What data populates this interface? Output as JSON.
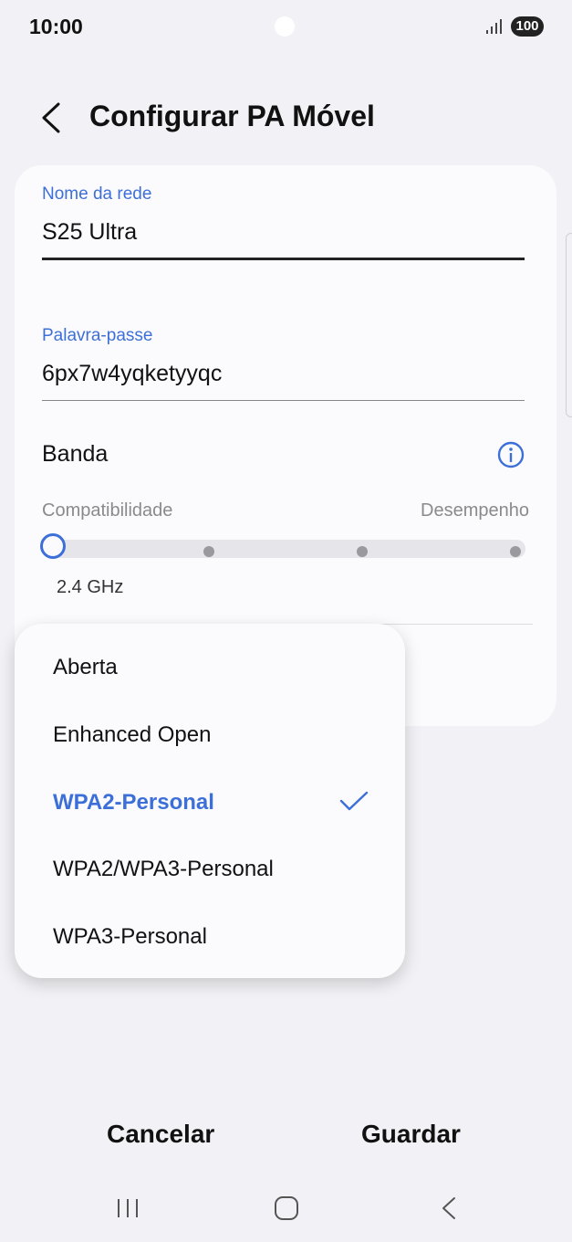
{
  "status_bar": {
    "time": "10:00",
    "battery": "100",
    "signal_icon": "signal-bars-icon"
  },
  "header": {
    "title": "Configurar PA Móvel",
    "back_icon": "chevron-left-icon"
  },
  "form": {
    "network_name": {
      "label": "Nome da rede",
      "value": "S25 Ultra"
    },
    "password": {
      "label": "Palavra-passe",
      "value": "6px7w4yqketyyqc"
    },
    "band": {
      "label": "Banda",
      "info_icon": "info-icon",
      "left_label": "Compatibilidade",
      "right_label": "Desempenho",
      "selected_value": "2.4 GHz",
      "selected_index": 0,
      "steps": 4
    }
  },
  "security_menu": {
    "options": [
      "Aberta",
      "Enhanced Open",
      "WPA2-Personal",
      "WPA2/WPA3-Personal",
      "WPA3-Personal"
    ],
    "selected": "WPA2-Personal",
    "selected_index": 2
  },
  "actions": {
    "cancel": "Cancelar",
    "save": "Guardar"
  },
  "nav_bar": {
    "recents_icon": "recents-icon",
    "home_icon": "home-icon",
    "back_icon": "back-icon"
  },
  "colors": {
    "accent": "#3d6fd8",
    "background": "#f2f2f6",
    "card": "#fbfbfd"
  }
}
